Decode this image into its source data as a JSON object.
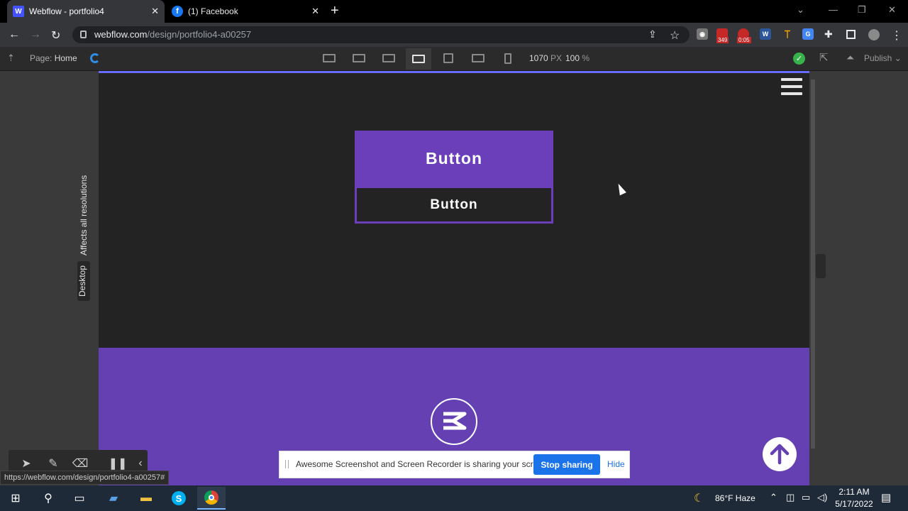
{
  "browser": {
    "tabs": [
      {
        "label": "Webflow - portfolio4",
        "active": true
      },
      {
        "label": "(1) Facebook",
        "active": false
      }
    ],
    "url_host": "webflow.com",
    "url_path": "/design/portfolio4-a00257",
    "ext_badges": {
      "badge1": "349",
      "badge2": "0:05"
    }
  },
  "webflow": {
    "page_label": "Page:",
    "page_name": "Home",
    "width_value": "1070",
    "width_unit": "PX",
    "zoom_value": "100",
    "zoom_unit": "%",
    "publish_label": "Publish",
    "side_labels": {
      "affects": "Affects all resolutions",
      "desktop": "Desktop"
    }
  },
  "canvas": {
    "button_primary": "Button",
    "button_secondary": "Button"
  },
  "status_url": "https://webflow.com/design/portfolio4-a00257#",
  "share_bar": {
    "message": "Awesome Screenshot and Screen Recorder is sharing your screen.",
    "stop_label": "Stop sharing",
    "hide_label": "Hide"
  },
  "taskbar": {
    "weather": "86°F  Haze",
    "time": "2:11 AM",
    "date": "5/17/2022"
  },
  "colors": {
    "brand_purple": "#6540b3",
    "button_purple": "#6a3fb9",
    "link_blue": "#1a73e8"
  }
}
